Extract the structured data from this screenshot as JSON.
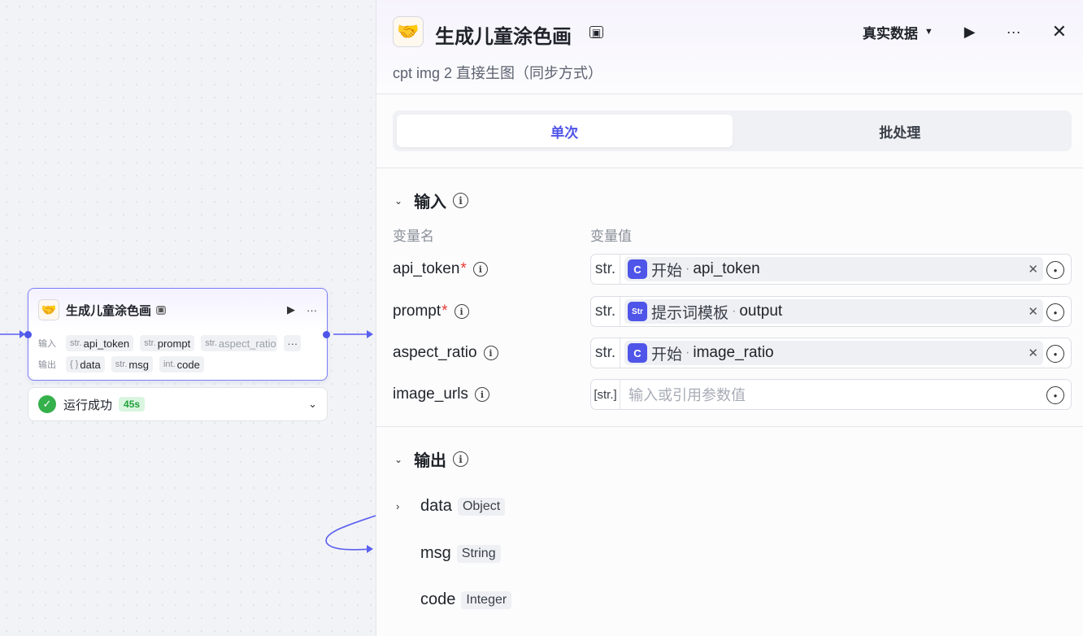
{
  "node": {
    "title": "生成儿童涂色画",
    "icon": "handshake-icon",
    "input_label": "输入",
    "output_label": "输出",
    "inputs": [
      {
        "type": "str.",
        "name": "api_token"
      },
      {
        "type": "str.",
        "name": "prompt"
      },
      {
        "type": "str.",
        "name": "aspect_ratio"
      }
    ],
    "more_label": "···",
    "outputs": [
      {
        "type": "{ }",
        "name": "data"
      },
      {
        "type": "str.",
        "name": "msg"
      },
      {
        "type": "int.",
        "name": "code"
      }
    ],
    "status": "运行成功",
    "duration": "45s"
  },
  "panel": {
    "title": "生成儿童涂色画",
    "subtitle": "cpt img 2 直接生图（同步方式）",
    "data_mode": "真实数据",
    "tabs": [
      {
        "label": "单次",
        "active": true
      },
      {
        "label": "批处理",
        "active": false
      }
    ],
    "input_section": {
      "title": "输入",
      "col_name": "变量名",
      "col_value": "变量值",
      "rows": [
        {
          "name": "api_token",
          "required": true,
          "type": "str.",
          "source": "开始",
          "source_icon": "C",
          "variable": "api_token"
        },
        {
          "name": "prompt",
          "required": true,
          "type": "str.",
          "source": "提示词模板",
          "source_icon": "Str",
          "variable": "output"
        },
        {
          "name": "aspect_ratio",
          "required": false,
          "type": "str.",
          "source": "开始",
          "source_icon": "C",
          "variable": "image_ratio"
        },
        {
          "name": "image_urls",
          "required": false,
          "type": "[str.]",
          "placeholder": "输入或引用参数值"
        }
      ]
    },
    "output_section": {
      "title": "输出",
      "rows": [
        {
          "name": "data",
          "type": "Object",
          "expandable": true
        },
        {
          "name": "msg",
          "type": "String",
          "expandable": false
        },
        {
          "name": "code",
          "type": "Integer",
          "expandable": false
        }
      ]
    }
  },
  "colors": {
    "accent": "#4f55e8",
    "success": "#35b14b",
    "required": "#e53935"
  }
}
